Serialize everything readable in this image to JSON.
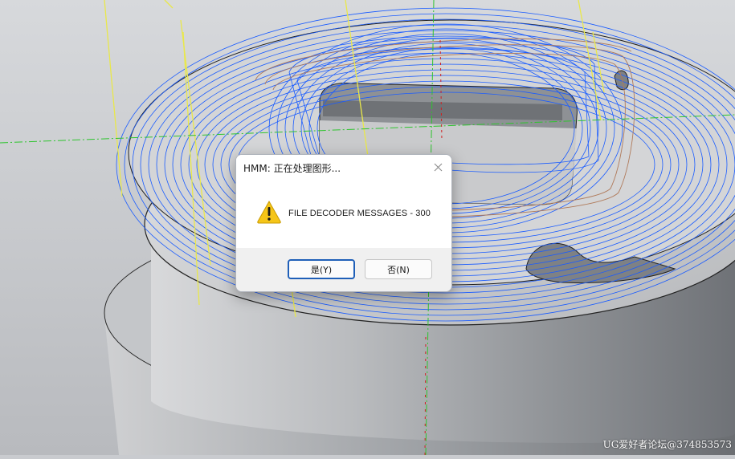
{
  "dialog": {
    "title": "HMM: 正在处理图形...",
    "message": "FILE DECODER MESSAGES - 300",
    "icon": "warning-icon",
    "close_icon": "close-icon",
    "buttons": {
      "yes_label": "是(Y)",
      "no_label": "否(N)"
    }
  },
  "viewport": {
    "watermark": "UG爱好者论坛@374853573"
  },
  "colors": {
    "toolpath_blue": "#1a5cff",
    "toolpath_brown": "#b07a5a",
    "axis_green": "#2ec42e",
    "axis_red": "#d02020",
    "wire_yellow": "#e9e84a",
    "part_gray": "#9a9da2",
    "default_button_border": "#1f5fb8"
  }
}
